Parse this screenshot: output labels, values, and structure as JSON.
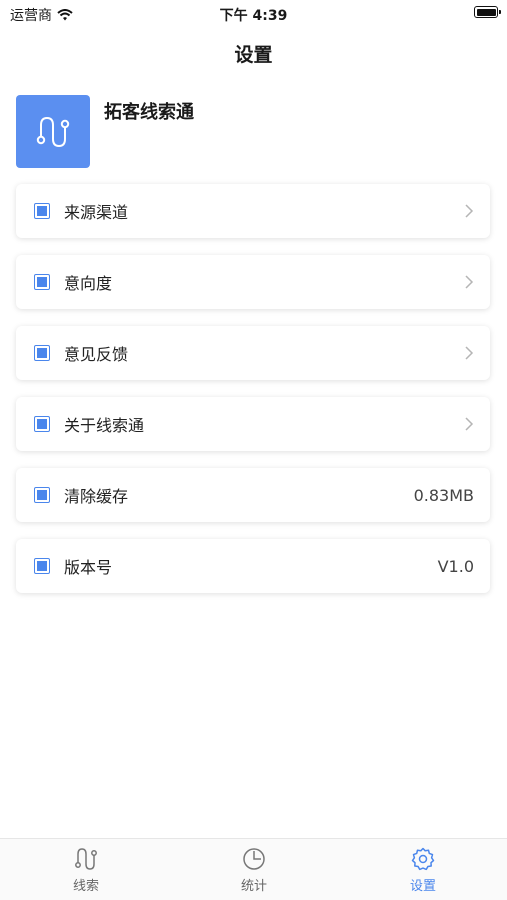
{
  "status_bar": {
    "carrier": "运营商",
    "time": "下午 4:39"
  },
  "nav": {
    "title": "设置"
  },
  "app": {
    "name": "拓客线索通"
  },
  "menu": [
    {
      "label": "来源渠道",
      "value": "",
      "has_arrow": true
    },
    {
      "label": "意向度",
      "value": "",
      "has_arrow": true
    },
    {
      "label": "意见反馈",
      "value": "",
      "has_arrow": true
    },
    {
      "label": "关于线索通",
      "value": "",
      "has_arrow": true
    },
    {
      "label": "清除缓存",
      "value": "0.83MB",
      "has_arrow": false
    },
    {
      "label": "版本号",
      "value": "V1.0",
      "has_arrow": false
    }
  ],
  "tabs": [
    {
      "label": "线索",
      "icon": "route-icon",
      "active": false
    },
    {
      "label": "统计",
      "icon": "clock-chart-icon",
      "active": false
    },
    {
      "label": "设置",
      "icon": "gear-icon",
      "active": true
    }
  ],
  "colors": {
    "accent": "#4a86ec",
    "logo_bg": "#5b8ff0"
  }
}
